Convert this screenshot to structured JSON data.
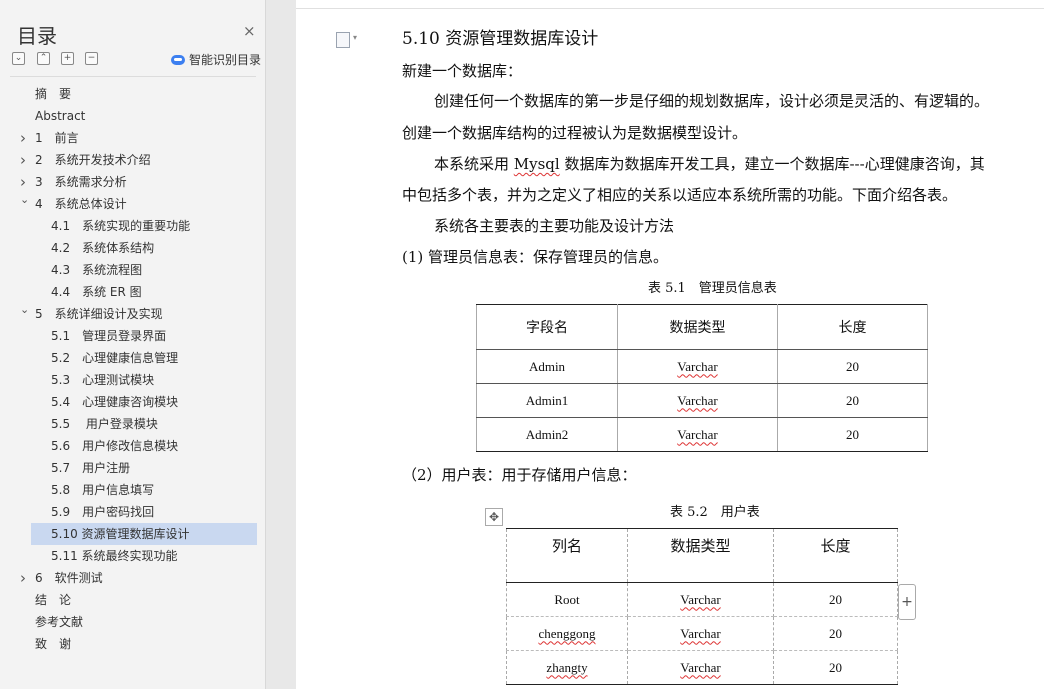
{
  "sidebar": {
    "title": "目录",
    "close_label": "×",
    "controls": [
      "⌄",
      "⌃",
      "+",
      "−"
    ],
    "smart_toc_label": "智能识别目录",
    "items": [
      {
        "label": "摘　要",
        "level": 0,
        "expandable": false
      },
      {
        "label": "Abstract",
        "level": 0,
        "expandable": false
      },
      {
        "label": "1　前言",
        "level": 0,
        "expandable": true,
        "expanded": false
      },
      {
        "label": "2　系统开发技术介绍",
        "level": 0,
        "expandable": true,
        "expanded": false
      },
      {
        "label": "3　系统需求分析",
        "level": 0,
        "expandable": true,
        "expanded": false
      },
      {
        "label": "4　系统总体设计",
        "level": 0,
        "expandable": true,
        "expanded": true
      },
      {
        "label": "4.1　系统实现的重要功能",
        "level": 1,
        "expandable": false
      },
      {
        "label": "4.2　系统体系结构",
        "level": 1,
        "expandable": false
      },
      {
        "label": "4.3　系统流程图",
        "level": 1,
        "expandable": false
      },
      {
        "label": "4.4　系统 ER 图",
        "level": 1,
        "expandable": false
      },
      {
        "label": "5　系统详细设计及实现",
        "level": 0,
        "expandable": true,
        "expanded": true
      },
      {
        "label": "5.1　管理员登录界面",
        "level": 1,
        "expandable": false
      },
      {
        "label": "5.2　心理健康信息管理",
        "level": 1,
        "expandable": false
      },
      {
        "label": "5.3　心理测试模块",
        "level": 1,
        "expandable": false
      },
      {
        "label": "5.4　心理健康咨询模块",
        "level": 1,
        "expandable": false
      },
      {
        "label": "5.5　 用户登录模块",
        "level": 1,
        "expandable": false
      },
      {
        "label": "5.6　用户修改信息模块",
        "level": 1,
        "expandable": false
      },
      {
        "label": "5.7　用户注册",
        "level": 1,
        "expandable": false
      },
      {
        "label": "5.8　用户信息填写",
        "level": 1,
        "expandable": false
      },
      {
        "label": "5.9　用户密码找回",
        "level": 1,
        "expandable": false
      },
      {
        "label": "5.10 资源管理数据库设计",
        "level": 1,
        "expandable": false,
        "selected": true
      },
      {
        "label": "5.11 系统最终实现功能",
        "level": 1,
        "expandable": false
      },
      {
        "label": "6　软件测试",
        "level": 0,
        "expandable": true,
        "expanded": false
      },
      {
        "label": "结　论",
        "level": 0,
        "expandable": false
      },
      {
        "label": "参考文献",
        "level": 0,
        "expandable": false
      },
      {
        "label": "致　谢",
        "level": 0,
        "expandable": false
      }
    ]
  },
  "document": {
    "heading": "5.10  资源管理数据库设计",
    "para1": "新建一个数据库：",
    "para2a": "创建任何一个数据库的第一步是仔细的规划数据库，设计必须是灵活的、有逻辑的。",
    "para2b": "创建一个数据库结构的过程被认为是数据模型设计。",
    "para3a_pre": "本系统采用 ",
    "para3a_mysql": "Mysql",
    "para3a_post": " 数据库为数据库开发工具，建立一个数据库---心理健康咨询，其",
    "para3b": "中包括多个表，并为之定义了相应的关系以适应本系统所需的功能。下面介绍各表。",
    "para4": "系统各主要表的主要功能及设计方法",
    "para5": "(1) 管理员信息表：保存管理员的信息。",
    "table1": {
      "caption": "表 5.1　管理员信息表",
      "headers": [
        "字段名",
        "数据类型",
        "长度"
      ],
      "rows": [
        [
          "Admin",
          "Varchar",
          "20"
        ],
        [
          "Admin1",
          "Varchar",
          "20"
        ],
        [
          "Admin2",
          "Varchar",
          "20"
        ]
      ]
    },
    "para6": "（2）用户表：用于存储用户信息：",
    "table2": {
      "caption": "表 5.2　用户表",
      "headers": [
        "列名",
        "数据类型",
        "长度"
      ],
      "rows": [
        [
          "Root",
          "Varchar",
          "20"
        ],
        [
          "chenggong",
          "Varchar",
          "20"
        ],
        [
          "zhangty",
          "Varchar",
          "20"
        ]
      ]
    }
  },
  "icons": {
    "move_handle": "✥",
    "add_column": "+"
  }
}
